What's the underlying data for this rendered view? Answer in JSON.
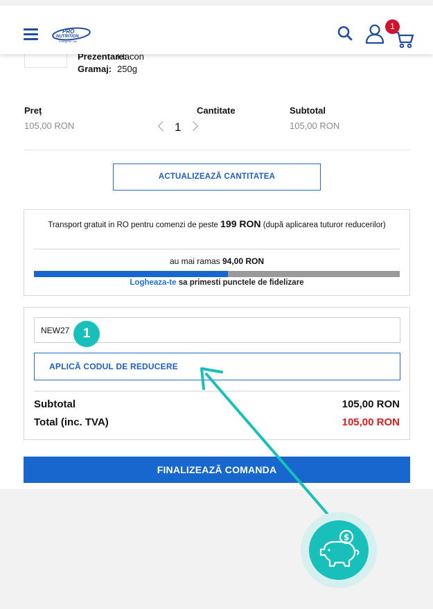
{
  "header": {
    "brand": "PRO NUTRITION",
    "brand_tagline": "Energy for Life",
    "cart_count": "1"
  },
  "product": {
    "presentation_label": "Prezentare:",
    "presentation_value": "Flacon",
    "weight_label": "Gramaj:",
    "weight_value": "250g"
  },
  "cart": {
    "price_header": "Preț",
    "qty_header": "Cantitate",
    "subtotal_header": "Subtotal",
    "price": "105,00 RON",
    "qty": "1",
    "subtotal": "105,00 RON",
    "update_button": "ACTUALIZEAZĂ CANTITATEA"
  },
  "shipping": {
    "text_before": "Transport gratuit in RO pentru comenzi de peste",
    "threshold": "199 RON",
    "text_after": "(după aplicarea tuturor reducerilor)",
    "remaining_prefix": "au mai ramas",
    "remaining_amount": "94,00 RON",
    "progress_fraction": 0.53,
    "login_link": "Logheaza-te",
    "login_text": "sa primesti punctele de fidelizare"
  },
  "coupon": {
    "code": "NEW27",
    "step_number": "1",
    "apply_button": "APLICĂ CODUL DE REDUCERE"
  },
  "totals": {
    "subtotal_label": "Subtotal",
    "subtotal_value": "105,00 RON",
    "total_label": "Total (inc. TVA)",
    "total_value": "105,00 RON"
  },
  "checkout": {
    "finalize_button": "FINALIZEAZĂ COMANDA"
  },
  "colors": {
    "primary": "#1767cf",
    "accent_teal": "#19c0bb",
    "total_red": "#dc1a1a",
    "badge_red": "#d2112b"
  }
}
